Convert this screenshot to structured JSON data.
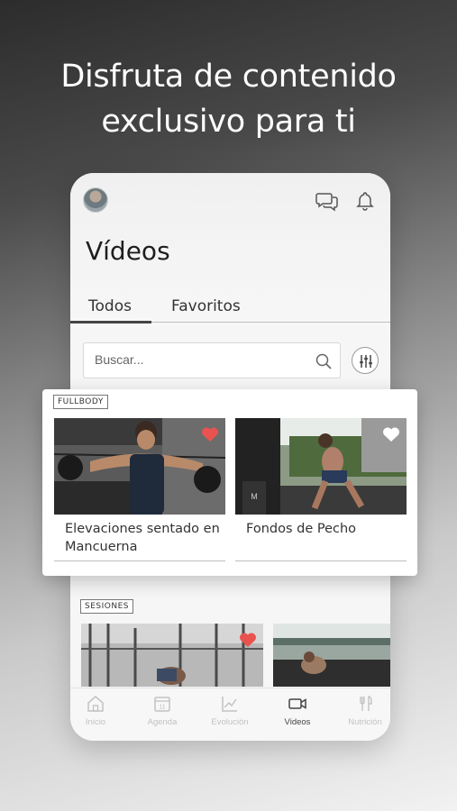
{
  "headline": {
    "line1": "Disfruta de contenido",
    "line2": "exclusivo para ti"
  },
  "screen": {
    "title": "Vídeos",
    "tabs": [
      {
        "label": "Todos",
        "active": true
      },
      {
        "label": "Favoritos",
        "active": false
      }
    ],
    "search": {
      "placeholder": "Buscar..."
    }
  },
  "sections": [
    {
      "badge": "FULLBODY",
      "videos": [
        {
          "title": "Elevaciones sentado en Mancuerna",
          "favorite": true
        },
        {
          "title": "Fondos de Pecho",
          "favorite": false
        }
      ]
    },
    {
      "badge": "SESIONES",
      "videos": [
        {
          "favorite": true
        },
        {
          "favorite": false
        }
      ]
    }
  ],
  "nav": {
    "items": [
      {
        "label": "Inicio",
        "icon": "home-icon",
        "active": false
      },
      {
        "label": "Agenda",
        "icon": "calendar-icon",
        "badge": "11",
        "active": false
      },
      {
        "label": "Evolución",
        "icon": "chart-icon",
        "active": false
      },
      {
        "label": "Videos",
        "icon": "video-icon",
        "active": true
      },
      {
        "label": "Nutrición",
        "icon": "cutlery-icon",
        "active": false
      }
    ]
  },
  "colors": {
    "heart": "#e8534f",
    "text": "#333333",
    "nav_inactive": "#c2c2c2"
  }
}
